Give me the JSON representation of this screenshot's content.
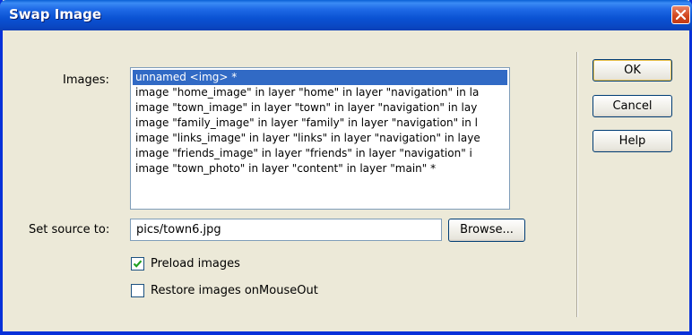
{
  "window": {
    "title": "Swap Image",
    "close_icon": "close-icon"
  },
  "images": {
    "label": "Images:",
    "items": [
      "unnamed <img> *",
      "image \"home_image\" in layer \"home\" in layer \"navigation\" in la",
      "image \"town_image\" in layer \"town\" in layer \"navigation\" in lay",
      "image \"family_image\" in layer \"family\" in layer \"navigation\" in l",
      "image \"links_image\" in layer \"links\" in layer \"navigation\" in laye",
      "image \"friends_image\" in layer \"friends\" in layer \"navigation\" i",
      "image \"town_photo\" in layer \"content\" in layer \"main\" *"
    ],
    "selected_index": 0
  },
  "source": {
    "label": "Set source to:",
    "value": "pics/town6.jpg",
    "browse_label": "Browse..."
  },
  "options": {
    "preload_label": "Preload images",
    "preload_checked": true,
    "restore_label": "Restore images onMouseOut",
    "restore_checked": false
  },
  "buttons": {
    "ok": "OK",
    "cancel": "Cancel",
    "help": "Help"
  },
  "colors": {
    "title_bar": "#0a52d3",
    "selection": "#316ac5",
    "dialog_bg": "#ece9d8"
  }
}
